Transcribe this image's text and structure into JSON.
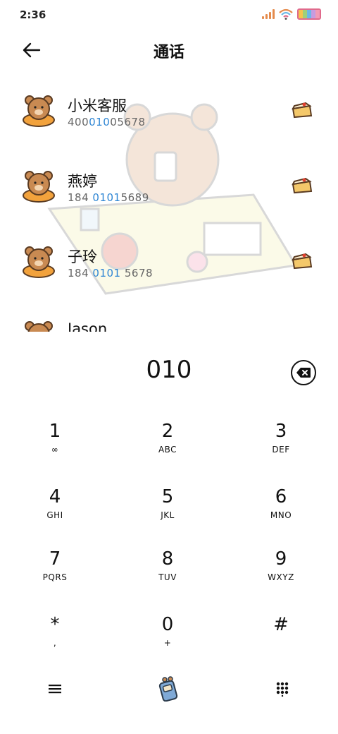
{
  "status": {
    "time": "2:36"
  },
  "header": {
    "title": "通话"
  },
  "contacts": [
    {
      "name": "小米客服",
      "num_pre": "400",
      "num_hl": "010",
      "num_post": "05678"
    },
    {
      "name": "燕婷",
      "num_pre": "184 ",
      "num_hl": "0101",
      "num_post": "5689"
    },
    {
      "name": "子玲",
      "num_pre": "184 ",
      "num_hl": "0101",
      "num_post": " 5678"
    },
    {
      "name": "Jason",
      "num_pre": "",
      "num_hl": "",
      "num_post": ""
    }
  ],
  "dialer": {
    "input": "010"
  },
  "keys": [
    {
      "d": "1",
      "l": "∞"
    },
    {
      "d": "2",
      "l": "ABC"
    },
    {
      "d": "3",
      "l": "DEF"
    },
    {
      "d": "4",
      "l": "GHI"
    },
    {
      "d": "5",
      "l": "JKL"
    },
    {
      "d": "6",
      "l": "MNO"
    },
    {
      "d": "7",
      "l": "PQRS"
    },
    {
      "d": "8",
      "l": "TUV"
    },
    {
      "d": "9",
      "l": "WXYZ"
    },
    {
      "d": "*",
      "l": ","
    },
    {
      "d": "0",
      "l": "+"
    },
    {
      "d": "#",
      "l": ""
    }
  ],
  "icons": {
    "menu": "menu-icon",
    "call": "call-icon",
    "keypad": "keypad-icon",
    "back": "back-arrow-icon",
    "backspace": "backspace-icon",
    "avatar": "bear-avatar-icon",
    "cake": "cake-icon"
  },
  "colors": {
    "highlight": "#2f86d4",
    "signal": "#e58b4c",
    "battery": "#e06a8c"
  }
}
